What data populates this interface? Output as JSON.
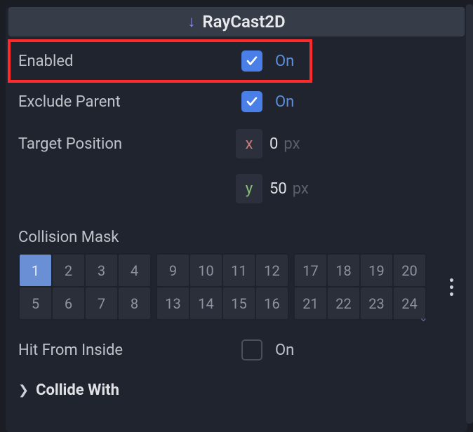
{
  "section": {
    "title": "RayCast2D"
  },
  "props": {
    "enabled": {
      "label": "Enabled",
      "on_text": "On",
      "checked": true
    },
    "exclude_parent": {
      "label": "Exclude Parent",
      "on_text": "On",
      "checked": true
    },
    "target_position": {
      "label": "Target Position",
      "x_axis": "x",
      "x_value": "0",
      "x_unit": "px",
      "y_axis": "y",
      "y_value": "50",
      "y_unit": "px"
    },
    "collision_mask": {
      "label": "Collision Mask",
      "groups": [
        [
          "1",
          "2",
          "3",
          "4",
          "5",
          "6",
          "7",
          "8"
        ],
        [
          "9",
          "10",
          "11",
          "12",
          "13",
          "14",
          "15",
          "16"
        ],
        [
          "17",
          "18",
          "19",
          "20",
          "21",
          "22",
          "23",
          "24"
        ]
      ],
      "active": [
        "1"
      ]
    },
    "hit_from_inside": {
      "label": "Hit From Inside",
      "on_text": "On",
      "checked": false
    },
    "collide_with": {
      "label": "Collide With"
    }
  }
}
